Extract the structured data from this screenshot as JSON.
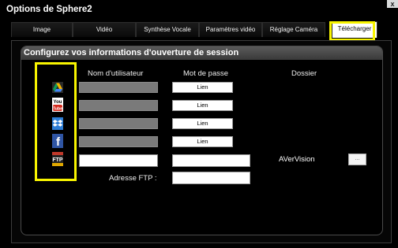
{
  "window": {
    "title": "Options de Sphere2",
    "close_glyph": "x"
  },
  "tabs": [
    {
      "label": "Image",
      "active": false
    },
    {
      "label": "Vidéo",
      "active": false
    },
    {
      "label": "Synthèse Vocale",
      "active": false
    },
    {
      "label": "Paramètres vidéo",
      "active": false
    },
    {
      "label": "Réglage Caméra",
      "active": false
    },
    {
      "label": "Télécharger",
      "active": true
    }
  ],
  "section": {
    "title": "Configurez vos informations d'ouverture de session",
    "columns": {
      "username": "Nom d'utilisateur",
      "password": "Mot de passe",
      "folder": "Dossier"
    }
  },
  "services": [
    {
      "icon": "google-drive-icon",
      "link_label": "Lien"
    },
    {
      "icon": "youtube-icon",
      "link_label": "Lien"
    },
    {
      "icon": "dropbox-icon",
      "link_label": "Lien"
    },
    {
      "icon": "facebook-icon",
      "link_label": "Lien"
    },
    {
      "icon": "ftp-icon",
      "icon_text": "FTP",
      "folder": "AVerVision",
      "browse_label": "..."
    }
  ],
  "ftp": {
    "address_label": "Adresse FTP :"
  },
  "colors": {
    "highlight": "#f8f400",
    "panel_header": "#4a4a4a"
  }
}
